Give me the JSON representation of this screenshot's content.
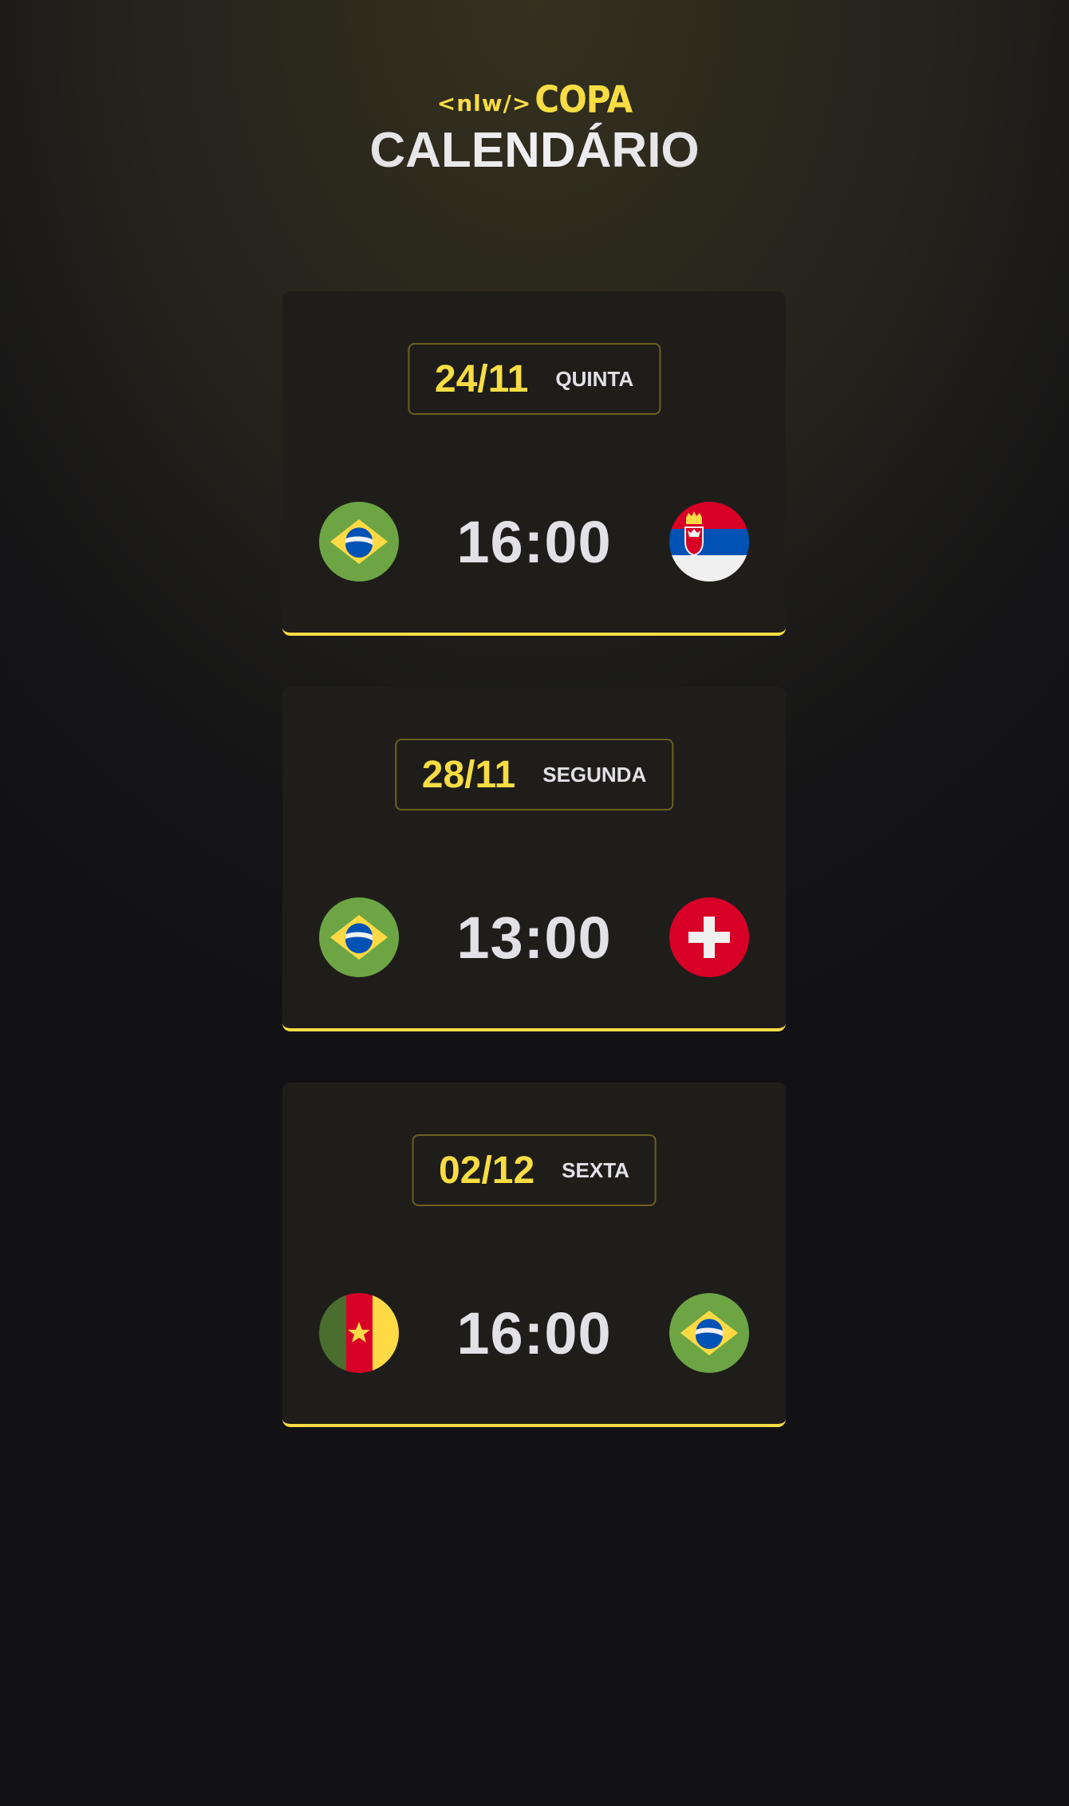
{
  "header": {
    "logo_code": "<nlw/>",
    "logo_word": "COPA",
    "title": "CALENDÁRIO"
  },
  "colors": {
    "accent": "#f7dd43",
    "card_bg": "#1f1d1a",
    "text": "#e1e1e6"
  },
  "matches": [
    {
      "date": "24/11",
      "weekday": "QUINTA",
      "time": "16:00",
      "home_flag": "brazil-flag-icon",
      "away_flag": "serbia-flag-icon"
    },
    {
      "date": "28/11",
      "weekday": "SEGUNDA",
      "time": "13:00",
      "home_flag": "brazil-flag-icon",
      "away_flag": "switzerland-flag-icon"
    },
    {
      "date": "02/12",
      "weekday": "SEXTA",
      "time": "16:00",
      "home_flag": "cameroon-flag-icon",
      "away_flag": "brazil-flag-icon"
    }
  ]
}
